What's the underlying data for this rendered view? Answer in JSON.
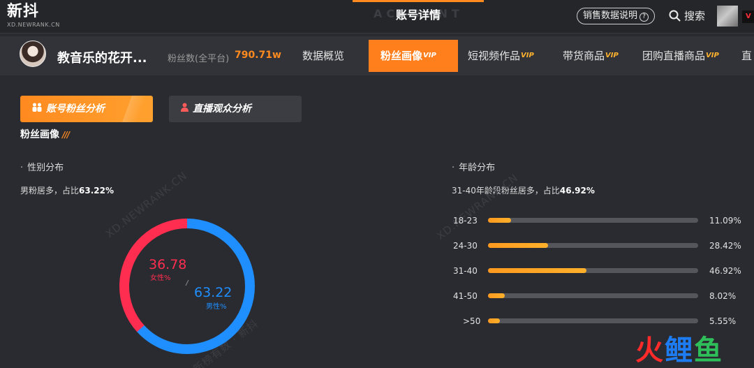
{
  "header": {
    "logo": "新抖",
    "logo_sub": "XD.NEWRANK.CN",
    "title": "账号详情",
    "title_watermark": "ACCOUNT",
    "sales_explain": "销售数据说明",
    "help_glyph": "?",
    "search": "搜索",
    "vip_corner": "V"
  },
  "account": {
    "name": "教音乐的花开...",
    "fans_label": "粉丝数(全平台)",
    "fans_value": "790.71w"
  },
  "nav": [
    {
      "label": "数据概览",
      "vip": ""
    },
    {
      "label": "粉丝画像",
      "vip": "VIP"
    },
    {
      "label": "短视频作品",
      "vip": "VIP"
    },
    {
      "label": "带货商品",
      "vip": "VIP"
    },
    {
      "label": "团购直播商品",
      "vip": "VIP"
    },
    {
      "label": "直",
      "vip": ""
    }
  ],
  "tabs": {
    "account_fans": "账号粉丝分析",
    "live_audience": "直播观众分析"
  },
  "section": {
    "title": "粉丝画像",
    "title_marks": "///"
  },
  "gender": {
    "title": "性别分布",
    "summary_prefix": "男粉居多，占比",
    "summary_value": "63.22%",
    "female_value": "36.78",
    "female_label": "女性%",
    "male_value": "63.22",
    "male_label": "男性%",
    "divider": "/"
  },
  "age": {
    "title": "年龄分布",
    "summary_prefix": "31-40年龄段粉丝居多，占比",
    "summary_value": "46.92%"
  },
  "watermarks": {
    "site": "XD.NEWRANK.CN",
    "cn": "新榜有数 · 新抖"
  },
  "brand": {
    "c1": "火",
    "c2": "鲤",
    "c3": "鱼"
  },
  "colors": {
    "accent": "#ff8a1f",
    "female": "#ff2d4f",
    "male": "#1f8fff",
    "bar": "#ffa024",
    "track": "#55565b"
  },
  "chart_data": [
    {
      "type": "pie",
      "title": "",
      "series": [
        {
          "name": "女性%",
          "value": 36.78
        },
        {
          "name": "男性%",
          "value": 63.22
        }
      ]
    },
    {
      "type": "bar",
      "title": "",
      "categories": [
        "18-23",
        "24-30",
        "31-40",
        "41-50",
        ">50"
      ],
      "values": [
        11.09,
        28.42,
        46.92,
        8.02,
        5.55
      ],
      "value_labels": [
        "11.09%",
        "28.42%",
        "46.92%",
        "8.02%",
        "5.55%"
      ],
      "ylim": [
        0,
        100
      ]
    }
  ]
}
